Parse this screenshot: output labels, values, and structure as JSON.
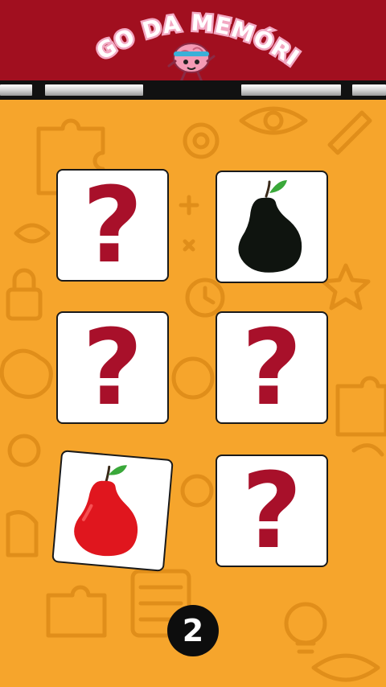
{
  "header": {
    "title": "JOGO DA MEMÓRIA",
    "mascot_icon": "brain-mascot-icon"
  },
  "colors": {
    "background": "#f6a52c",
    "header": "#a10f1f",
    "question_mark": "#a8102a",
    "card": "#ffffff"
  },
  "progress_segments": 5,
  "cards": [
    {
      "state": "hidden",
      "label": "?"
    },
    {
      "state": "revealed",
      "fruit": "black-pear-icon"
    },
    {
      "state": "hidden",
      "label": "?"
    },
    {
      "state": "hidden",
      "label": "?"
    },
    {
      "state": "revealed",
      "fruit": "red-pear-icon"
    },
    {
      "state": "hidden",
      "label": "?"
    }
  ],
  "page_number": "2"
}
